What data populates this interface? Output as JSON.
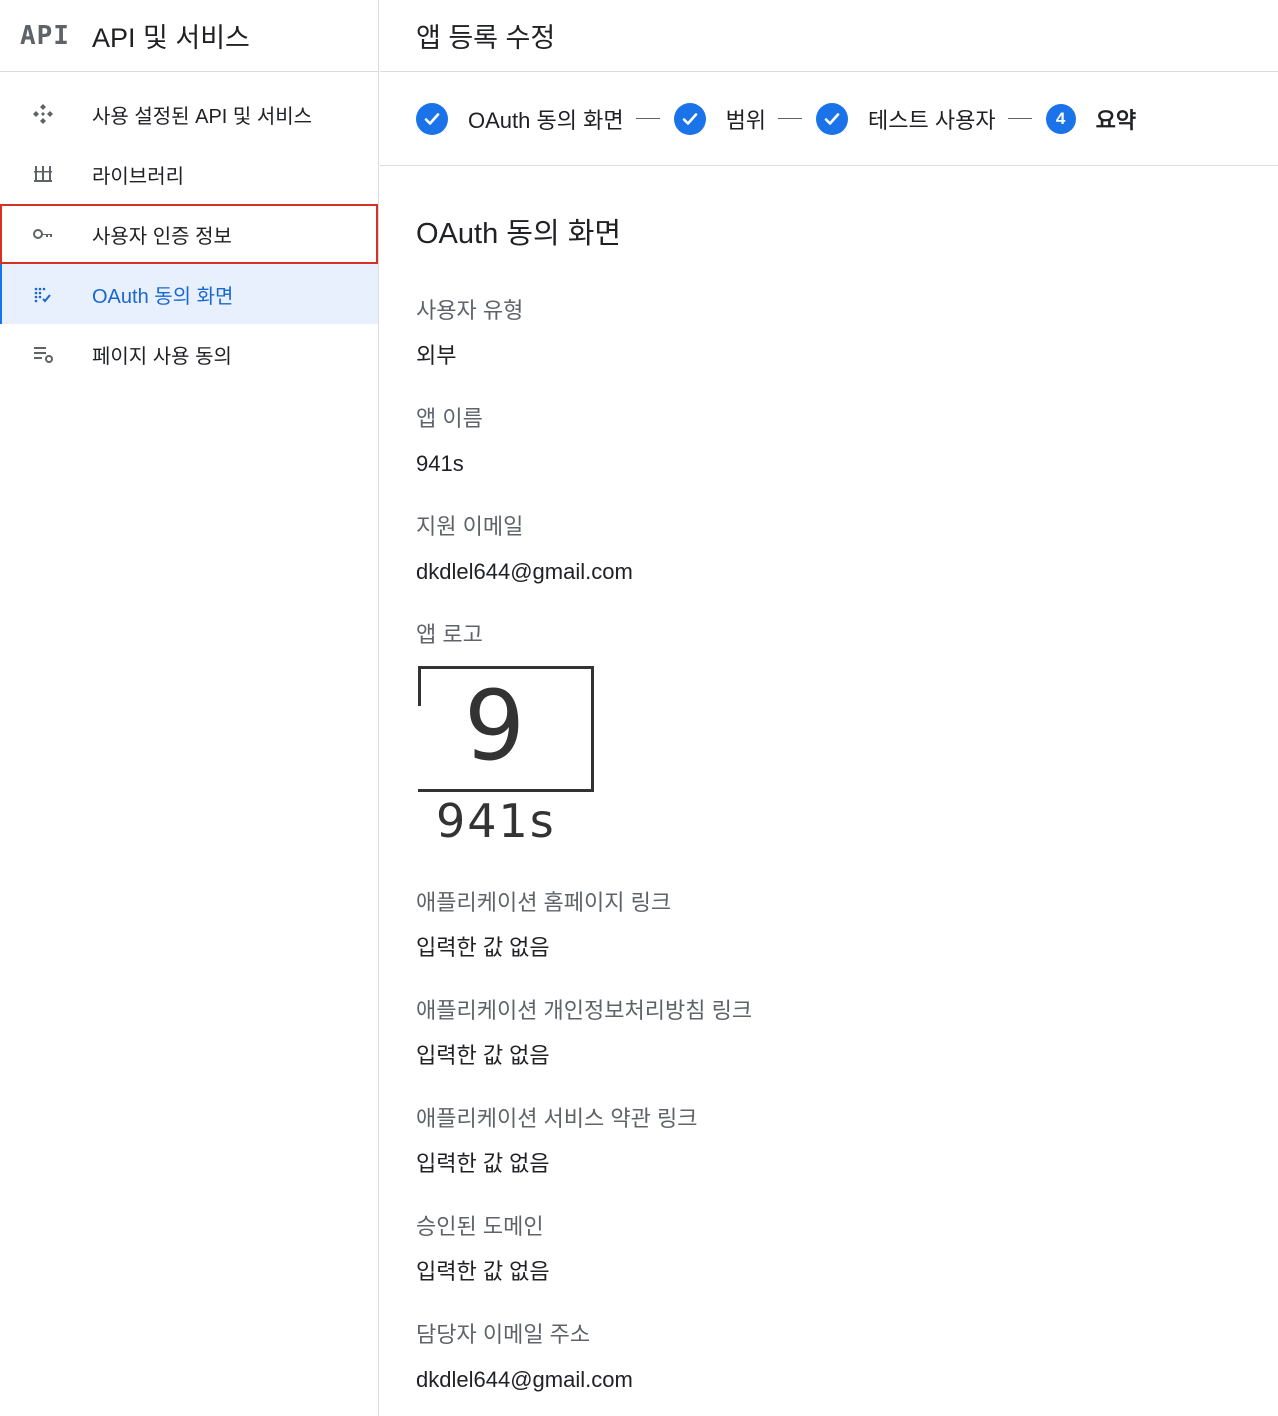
{
  "sidebar": {
    "logo": "API",
    "title": "API 및 서비스",
    "items": [
      {
        "label": "사용 설정된 API 및 서비스",
        "icon": "diamond-grid-icon"
      },
      {
        "label": "라이브러리",
        "icon": "library-icon"
      },
      {
        "label": "사용자 인증 정보",
        "icon": "key-icon"
      },
      {
        "label": "OAuth 동의 화면",
        "icon": "consent-icon"
      },
      {
        "label": "페이지 사용 동의",
        "icon": "settings-list-icon"
      }
    ]
  },
  "main": {
    "title": "앱 등록 수정",
    "stepper": {
      "steps": [
        {
          "label": "OAuth 동의 화면",
          "state": "done"
        },
        {
          "label": "범위",
          "state": "done"
        },
        {
          "label": "테스트 사용자",
          "state": "done"
        },
        {
          "label": "요약",
          "state": "current",
          "number": "4"
        }
      ]
    },
    "section_title": "OAuth 동의 화면",
    "fields": {
      "user_type": {
        "label": "사용자 유형",
        "value": "외부"
      },
      "app_name": {
        "label": "앱 이름",
        "value": "941s"
      },
      "support_email": {
        "label": "지원 이메일",
        "value": "dkdlel644@gmail.com"
      },
      "app_logo": {
        "label": "앱 로고",
        "logo_digit": "9",
        "logo_text": "941s"
      },
      "homepage_link": {
        "label": "애플리케이션 홈페이지 링크",
        "value": "입력한 값 없음"
      },
      "privacy_link": {
        "label": "애플리케이션 개인정보처리방침 링크",
        "value": "입력한 값 없음"
      },
      "tos_link": {
        "label": "애플리케이션 서비스 약관 링크",
        "value": "입력한 값 없음"
      },
      "authorized_domains": {
        "label": "승인된 도메인",
        "value": "입력한 값 없음"
      },
      "developer_email": {
        "label": "담당자 이메일 주소",
        "value": "dkdlel644@gmail.com"
      }
    }
  },
  "colors": {
    "accent": "#1a73e8",
    "active_bg": "#e8f0fe",
    "highlight": "#d93025"
  }
}
